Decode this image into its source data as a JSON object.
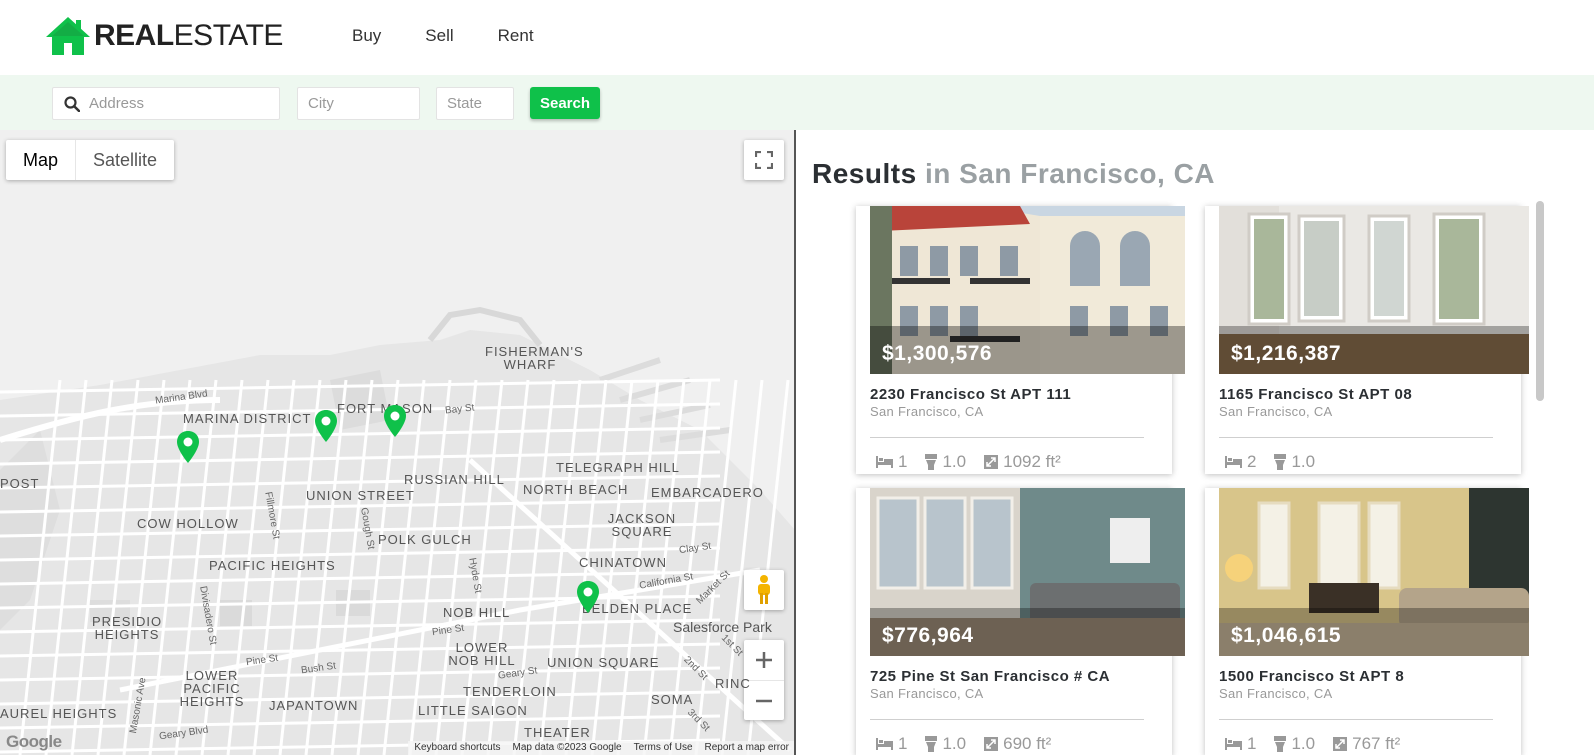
{
  "brand": {
    "bold": "REAL",
    "light": "ESTATE"
  },
  "nav": [
    "Buy",
    "Sell",
    "Rent"
  ],
  "search": {
    "address_placeholder": "Address",
    "city_placeholder": "City",
    "state_placeholder": "State",
    "button_label": "Search"
  },
  "map": {
    "type_options": [
      "Map",
      "Satellite"
    ],
    "active_type": "Map",
    "labels": {
      "fishermans_wharf": "FISHERMAN'S WHARF",
      "marina_district": "MARINA DISTRICT",
      "fort_mason": "FORT MASON",
      "telegraph_hill": "TELEGRAPH HILL",
      "russian_hill": "RUSSIAN HILL",
      "north_beach": "NORTH BEACH",
      "embarcadero": "EMBARCADERO",
      "union_street": "UNION STREET",
      "cow_hollow": "COW HOLLOW",
      "jackson_square": "JACKSON SQUARE",
      "polk_gulch": "POLK GULCH",
      "chinatown": "CHINATOWN",
      "pacific_heights": "PACIFIC HEIGHTS",
      "belden_place": "BELDEN PLACE",
      "salesforce_park": "Salesforce Park",
      "presidio_heights": "PRESIDIO HEIGHTS",
      "nob_hill": "NOB HILL",
      "lower_nob_hill": "LOWER NOB HILL",
      "union_square": "UNION SQUARE",
      "lower_pacific_heights": "LOWER PACIFIC HEIGHTS",
      "tenderloin": "TENDERLOIN",
      "soma": "SOMA",
      "japantown": "JAPANTOWN",
      "little_saigon": "LITTLE SAIGON",
      "laurel_heights": "AUREL HEIGHTS",
      "post": "POST",
      "rincon": "RINC",
      "theater": "THEATER"
    },
    "streets": {
      "marina_blvd": "Marina Blvd",
      "bay_st": "Bay St",
      "fillmore_st": "Fillmore St",
      "gough_st": "Gough St",
      "hyde_st": "Hyde St",
      "clay_st": "Clay St",
      "california_st": "California St",
      "market_st": "Market St",
      "divisadero_st": "Divisadero St",
      "pine_st_1": "Pine St",
      "pine_st_2": "Pine St",
      "bush_st": "Bush St",
      "geary_st_1": "Geary St",
      "geary_st_2": "Geary Blvd",
      "masonic_ave": "Masonic Ave",
      "first_st": "1st St",
      "second_st": "2nd St",
      "third_st": "3rd St"
    },
    "footer": [
      "Keyboard shortcuts",
      "Map data ©2023 Google",
      "Terms of Use",
      "Report a map error"
    ],
    "attribution": "Google"
  },
  "results": {
    "heading": "Results",
    "location": "in San Francisco, CA",
    "listings": [
      {
        "price": "$1,300,576",
        "address": "2230 Francisco St APT 111",
        "city": "San Francisco, CA",
        "beds": "1",
        "baths": "1.0",
        "area": "1092 ft²"
      },
      {
        "price": "$1,216,387",
        "address": "1165 Francisco St APT 08",
        "city": "San Francisco, CA",
        "beds": "2",
        "baths": "1.0",
        "area": ""
      },
      {
        "price": "$776,964",
        "address": "725 Pine St San Francisco # CA",
        "city": "San Francisco, CA",
        "beds": "1",
        "baths": "1.0",
        "area": "690 ft²"
      },
      {
        "price": "$1,046,615",
        "address": "1500 Francisco St APT 8",
        "city": "San Francisco, CA",
        "beds": "1",
        "baths": "1.0",
        "area": "767 ft²"
      }
    ]
  },
  "colors": {
    "accent": "#0fc14a",
    "search_bar_bg": "#eef8f0",
    "map_bg": "#f1f1f1"
  }
}
